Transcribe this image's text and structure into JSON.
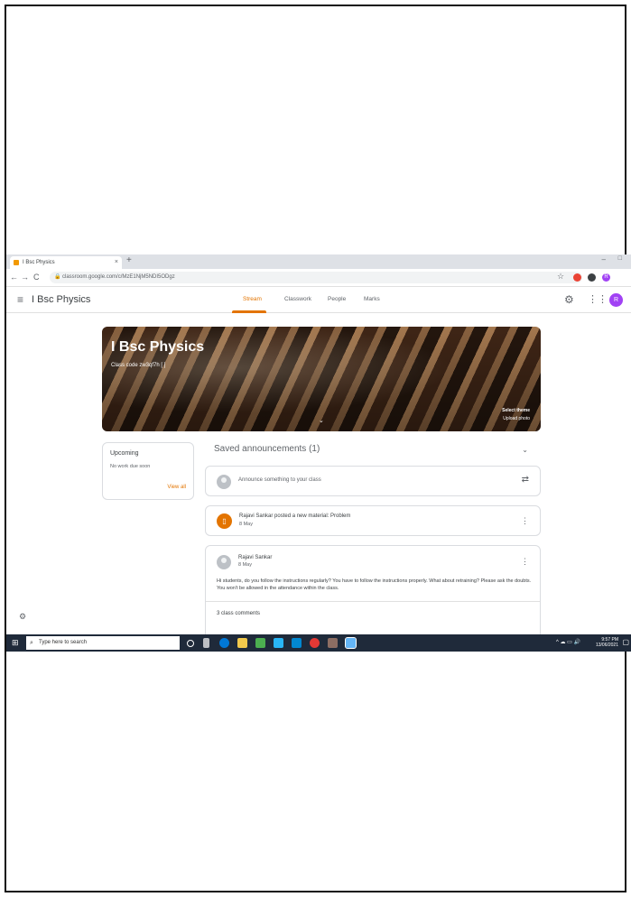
{
  "browser": {
    "tab_title": "I Bsc Physics",
    "tab_close": "×",
    "new_tab": "+",
    "url": "classroom.google.com/c/MzE1NjM5NDI5ODgz",
    "nav_back": "←",
    "nav_forward": "→",
    "nav_reload": "C",
    "profile_initial": "R"
  },
  "header": {
    "menu_icon": "≡",
    "class_name": "I Bsc Physics",
    "tabs": [
      {
        "label": "Stream"
      },
      {
        "label": "Classwork"
      },
      {
        "label": "People"
      },
      {
        "label": "Marks"
      }
    ],
    "profile_initial": "R"
  },
  "banner": {
    "title": "I Bsc Physics",
    "class_code": "Class code  zw3qf7h [ ]",
    "select_theme": "Select theme",
    "upload_photo": "Upload photo"
  },
  "upcoming": {
    "title": "Upcoming",
    "text": "No work due soon",
    "view_all": "View all"
  },
  "stream": {
    "saved_title": "Saved announcements (1)",
    "announce_placeholder": "Announce something to your class",
    "material": {
      "text": "Rajavi Sankar posted a new material: Problem",
      "date": "8 May"
    },
    "post": {
      "author": "Rajavi Sankar",
      "date": "8 May",
      "body": "Hi students, do you follow the instructions regularly? You have to follow the instructions properly. What about retraining? Please ask the doubts. You won't be allowed in the attendance within the class.",
      "comments": "3 class comments"
    }
  },
  "taskbar": {
    "search_placeholder": "Type here to search",
    "time": "9:57 PM",
    "date": "13/06/2021"
  },
  "colors": {
    "accent": "#e37400",
    "taskbar": "#1f2a3a",
    "profile": "#a142f4"
  }
}
